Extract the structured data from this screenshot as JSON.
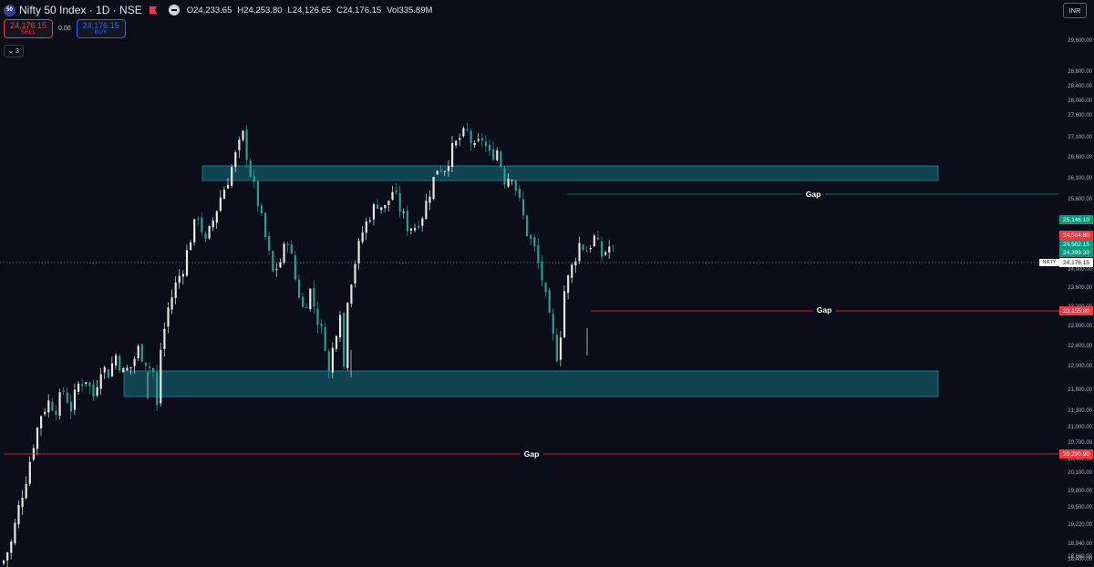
{
  "header": {
    "logo_text": "50",
    "symbol_title": "Nifty 50 Index · 1D · NSE",
    "open_label": "O",
    "open": "24,233.65",
    "high_label": "H",
    "high": "24,253.80",
    "low_label": "L",
    "low": "24,126.65",
    "close_label": "C",
    "close": "24,176.15",
    "vol_label": "Vol",
    "volume": "335.89M"
  },
  "trade": {
    "sell_price": "24,176.15",
    "sell_label": "SELL",
    "spread": "0.00",
    "buy_price": "24,176.15",
    "buy_label": "BUY"
  },
  "indicators": {
    "collapse_count": "3"
  },
  "currency": "INR",
  "price_axis": {
    "ticks": [
      "29,600.00",
      "28,800.00",
      "28,400.00",
      "28,000.00",
      "27,600.00",
      "27,100.00",
      "26,600.00",
      "26,100.00",
      "25,600.00",
      "25,100.00",
      "24,800.00",
      "24,400.00",
      "24,000.00",
      "23,600.00",
      "23,200.00",
      "22,800.00",
      "22,400.00",
      "22,000.00",
      "21,600.00",
      "21,300.00",
      "21,000.00",
      "20,700.00",
      "20,400.00",
      "20,100.00",
      "19,800.00",
      "19,500.00",
      "19,220.00",
      "18,940.00",
      "18,660.00",
      "18,400.00"
    ]
  },
  "price_labels": {
    "gap_upper": "25,146.10",
    "red1": "24,564.80",
    "green1": "24,502.15",
    "green2": "24,399.30",
    "last": "24,176.15",
    "gap_mid": "23,155.80",
    "gap_low": "20,290.90"
  },
  "symbol_tag": "NIFTY",
  "gap_labels": {
    "upper": "Gap",
    "middle": "Gap",
    "lower": "Gap"
  },
  "colors": {
    "background": "#0b0d18",
    "zone_fill": "#0f4450",
    "zone_border": "#1e8a96",
    "up_candle": "#e6e6e6",
    "down_candle": "#2a9d8f",
    "gap_upper_line": "#089981",
    "gap_red_line": "#f23645"
  },
  "chart_data": {
    "type": "candlestick",
    "symbol": "NIFTY",
    "interval": "1D",
    "last_price": 24176.15,
    "zones": [
      {
        "from": 25850,
        "to": 26300
      },
      {
        "from": 21450,
        "to": 22050
      }
    ],
    "gap_levels": [
      25146.1,
      23155.8,
      20290.9
    ],
    "close_path": [
      [
        0,
        18900
      ],
      [
        2,
        19200
      ],
      [
        4,
        19800
      ],
      [
        6,
        20300
      ],
      [
        8,
        20900
      ],
      [
        10,
        21400
      ],
      [
        12,
        21600
      ],
      [
        14,
        21500
      ],
      [
        16,
        21800
      ],
      [
        18,
        21500
      ],
      [
        20,
        21900
      ],
      [
        22,
        22000
      ],
      [
        24,
        21700
      ],
      [
        26,
        22200
      ],
      [
        28,
        22100
      ],
      [
        30,
        22400
      ],
      [
        32,
        22100
      ],
      [
        34,
        22200
      ],
      [
        36,
        22500
      ],
      [
        38,
        22300
      ],
      [
        40,
        22100
      ],
      [
        41,
        21500
      ],
      [
        42,
        22500
      ],
      [
        44,
        23200
      ],
      [
        46,
        23600
      ],
      [
        48,
        23900
      ],
      [
        50,
        24400
      ],
      [
        52,
        24800
      ],
      [
        54,
        24300
      ],
      [
        56,
        24700
      ],
      [
        58,
        25100
      ],
      [
        60,
        25400
      ],
      [
        62,
        25800
      ],
      [
        64,
        26150
      ],
      [
        66,
        25500
      ],
      [
        68,
        25000
      ],
      [
        70,
        24400
      ],
      [
        72,
        23800
      ],
      [
        74,
        24000
      ],
      [
        76,
        24400
      ],
      [
        78,
        23700
      ],
      [
        80,
        23200
      ],
      [
        82,
        23500
      ],
      [
        84,
        23000
      ],
      [
        86,
        22600
      ],
      [
        87,
        22100
      ],
      [
        88,
        22500
      ],
      [
        90,
        23200
      ],
      [
        91,
        22200
      ],
      [
        92,
        23400
      ],
      [
        94,
        24000
      ],
      [
        96,
        24500
      ],
      [
        98,
        24800
      ],
      [
        100,
        25000
      ],
      [
        102,
        24900
      ],
      [
        104,
        25200
      ],
      [
        106,
        24900
      ],
      [
        108,
        24600
      ],
      [
        110,
        24600
      ],
      [
        112,
        24800
      ],
      [
        114,
        25200
      ],
      [
        116,
        25600
      ],
      [
        118,
        25600
      ],
      [
        120,
        25900
      ],
      [
        122,
        26100
      ],
      [
        124,
        26200
      ],
      [
        126,
        25900
      ],
      [
        128,
        26100
      ],
      [
        130,
        25800
      ],
      [
        132,
        25900
      ],
      [
        134,
        25400
      ],
      [
        136,
        25500
      ],
      [
        138,
        25000
      ],
      [
        140,
        24500
      ],
      [
        142,
        24200
      ],
      [
        144,
        23700
      ],
      [
        146,
        23000
      ],
      [
        148,
        22400
      ],
      [
        149,
        22800
      ],
      [
        150,
        23500
      ],
      [
        152,
        23900
      ],
      [
        154,
        24300
      ],
      [
        156,
        24200
      ],
      [
        158,
        24400
      ],
      [
        160,
        24100
      ],
      [
        162,
        24250
      ],
      [
        163,
        24176
      ]
    ]
  }
}
